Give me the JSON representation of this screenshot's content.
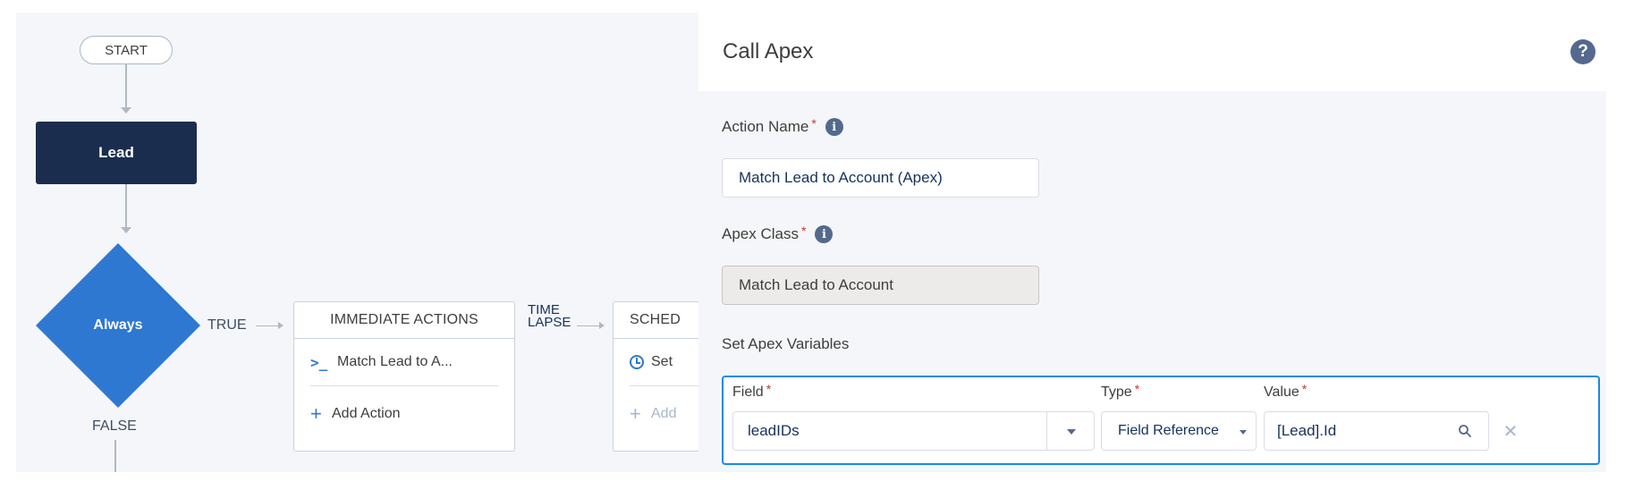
{
  "canvas": {
    "start_label": "START",
    "object_label": "Lead",
    "criteria_label": "Always",
    "true_label": "TRUE",
    "false_label": "FALSE",
    "immediate": {
      "header": "IMMEDIATE ACTIONS",
      "action_label": "Match Lead to A...",
      "add_action_label": "Add Action"
    },
    "time_lapse_line1": "TIME",
    "time_lapse_line2": "LAPSE",
    "scheduled": {
      "header": "SCHED",
      "action_label": "Set",
      "add_action_label": "Add"
    }
  },
  "panel": {
    "title": "Call Apex",
    "help_icon": "?",
    "action_name": {
      "label": "Action Name",
      "value": "Match Lead to Account (Apex)"
    },
    "apex_class": {
      "label": "Apex Class",
      "value": "Match Lead to Account"
    },
    "variables": {
      "section_label": "Set Apex Variables",
      "field_label": "Field",
      "type_label": "Type",
      "value_label": "Value",
      "field_value": "leadIDs",
      "type_value": "Field Reference",
      "value_value": "[Lead].Id"
    },
    "required_mark": "*",
    "info_mark": "i",
    "remove_mark": "✕"
  },
  "colors": {
    "object_node": "#1b2d4f",
    "criteria_node": "#2e78d1",
    "required": "#c23934",
    "focus_border": "#1589ee"
  }
}
